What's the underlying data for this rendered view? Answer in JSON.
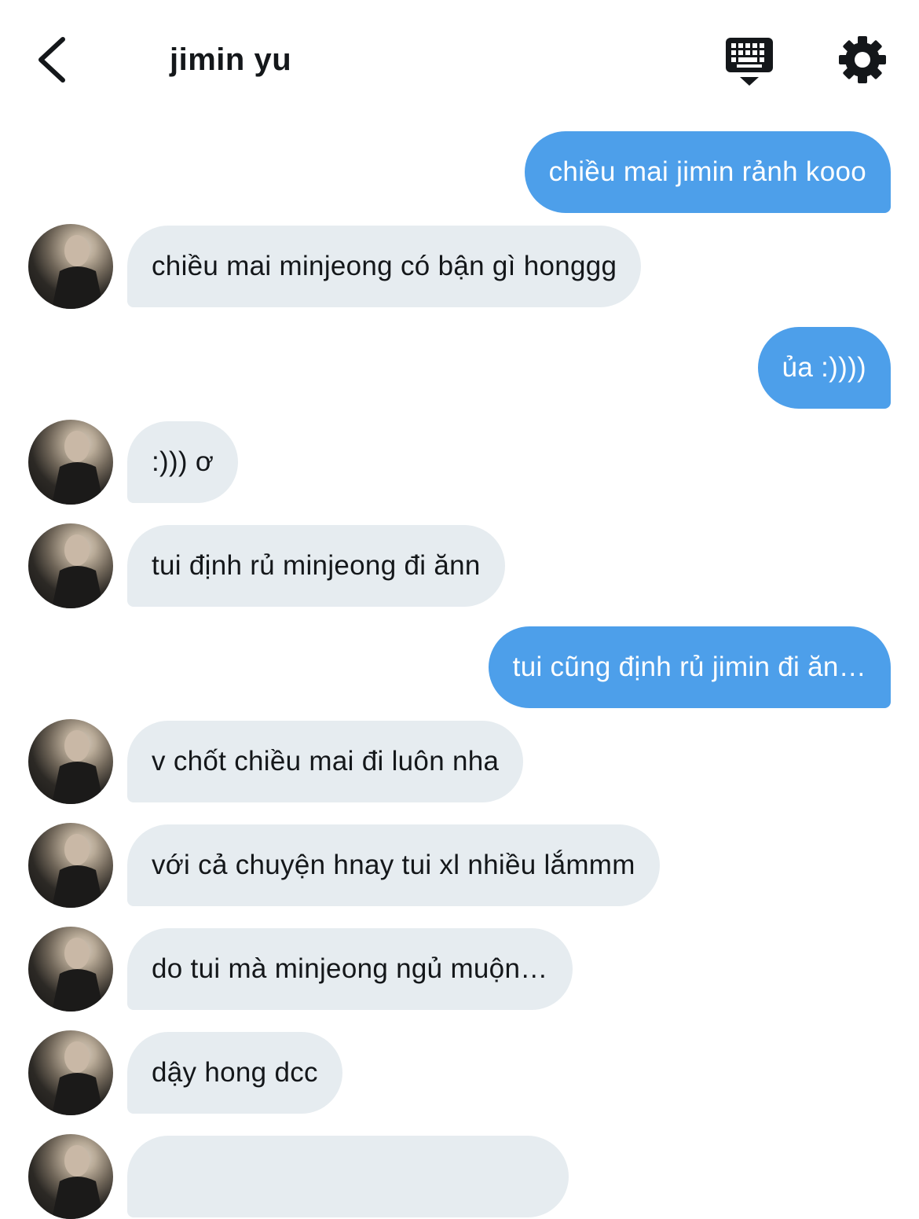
{
  "header": {
    "title": "jimin yu",
    "back_icon": "chevron-left-icon",
    "keyboard_icon": "keyboard-icon",
    "settings_icon": "gear-icon"
  },
  "colors": {
    "sent_bubble": "#4d9fea",
    "received_bubble": "#e6ecf0",
    "text": "#14171a"
  },
  "messages": [
    {
      "direction": "sent",
      "text": "chiều mai jimin rảnh kooo"
    },
    {
      "direction": "received",
      "text": "chiều mai minjeong có bận gì honggg"
    },
    {
      "direction": "sent",
      "text": "ủa :))))"
    },
    {
      "direction": "received",
      "text": ":))) ơ"
    },
    {
      "direction": "received",
      "text": "tui định rủ minjeong đi ănn"
    },
    {
      "direction": "sent",
      "text": "tui cũng định rủ jimin đi ăn…"
    },
    {
      "direction": "received",
      "text": "v chốt chiều mai đi luôn nha"
    },
    {
      "direction": "received",
      "text": "với cả chuyện hnay tui xl nhiều lắmmm"
    },
    {
      "direction": "received",
      "text": "do tui mà minjeong ngủ muộn…"
    },
    {
      "direction": "received",
      "text": "dậy hong dcc"
    },
    {
      "direction": "received",
      "text": ""
    }
  ]
}
